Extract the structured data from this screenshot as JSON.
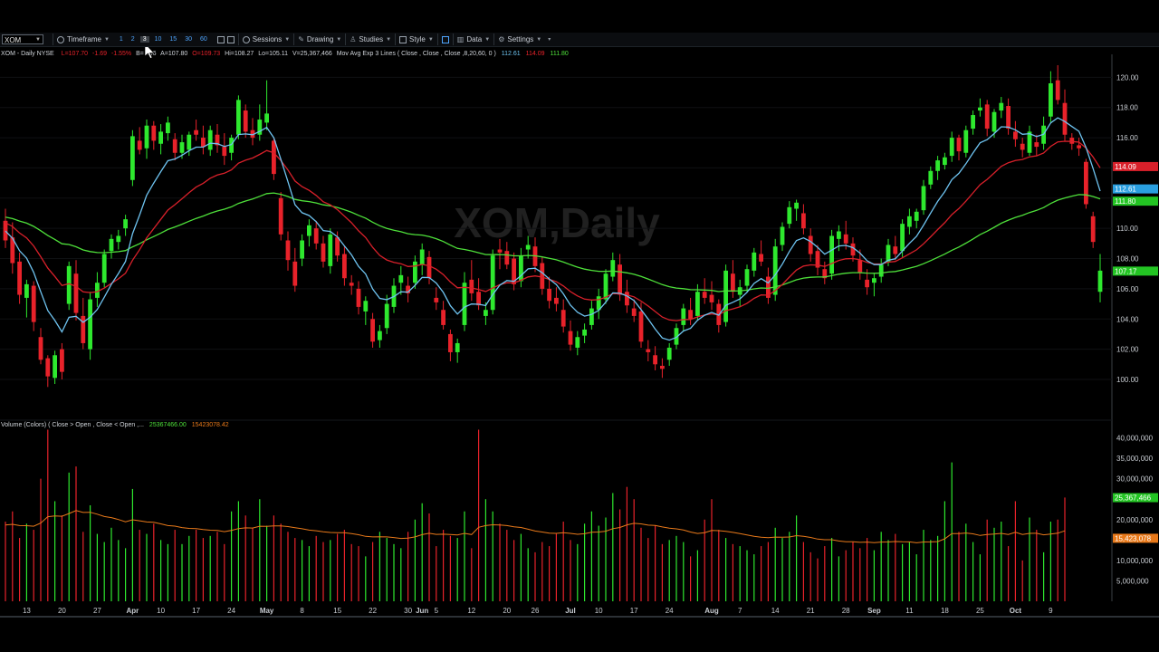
{
  "toolbar": {
    "symbol": "XOM",
    "timeframe": "Timeframe",
    "intervals": [
      "1",
      "2",
      "3",
      "10",
      "15",
      "30",
      "60"
    ],
    "selected_interval": "3",
    "sessions": "Sessions",
    "drawing": "Drawing",
    "studies": "Studies",
    "style": "Style",
    "data": "Data",
    "settings": "Settings"
  },
  "header": {
    "symbol_desc": "XOM - Daily  NYSE",
    "last": "L=107.70",
    "change": "-1.69",
    "change_pct": "-1.55%",
    "b": "B=",
    "b_val": ".06",
    "a": "A=107.80",
    "o": "O=109.73",
    "hi": "Hi=108.27",
    "lo": "Lo=105.11",
    "vol": "V=25,367,466",
    "study": "Mov Avg Exp 3 Lines ( Close , Close , Close ,8,20,60, 0 )",
    "ma1": "112.61",
    "ma2": "114.09",
    "ma3": "111.80"
  },
  "watermark": "XOM,Daily",
  "volume_header": {
    "label": "Volume (Colors) ( Close > Open , Close < Open ,...",
    "v1": "25367466.00",
    "v2": "15423078.42"
  },
  "colors": {
    "up": "#2ee82e",
    "down": "#e8222a",
    "ma_fast": "#6ec3f0",
    "ma_mid": "#d8202a",
    "ma_slow": "#4ee03a",
    "vol_avg": "#e8791a"
  },
  "chart_data": {
    "type": "candlestick",
    "price_ticks": [
      120.0,
      118.0,
      116.0,
      114.0,
      112.0,
      110.0,
      108.0,
      106.0,
      104.0,
      102.0,
      100.0
    ],
    "price_tick_labels": [
      "120.00",
      "118.00",
      "116.00",
      "",
      "",
      "110.00",
      "108.00",
      "106.00",
      "104.00",
      "102.00",
      "100.00"
    ],
    "price_range": [
      98.5,
      120.8
    ],
    "price_markers": [
      {
        "label": "114.09",
        "value": 114.09,
        "color": "#d8202a"
      },
      {
        "label": "112.61",
        "value": 112.61,
        "color": "#2a9fe0"
      },
      {
        "label": "111.80",
        "value": 111.8,
        "color": "#23c423"
      },
      {
        "label": "107.17",
        "value": 107.17,
        "color": "#23c423"
      }
    ],
    "volume_ticks": [
      40000000,
      35000000,
      30000000,
      25000000,
      20000000,
      15000000,
      10000000,
      5000000
    ],
    "volume_tick_labels": [
      "40,000,000",
      "35,000,000",
      "30,000,000",
      "",
      "20,000,000",
      "",
      "10,000,000",
      "5,000,000"
    ],
    "volume_range": [
      0,
      43000000
    ],
    "volume_markers": [
      {
        "label": "25,367,466",
        "value": 25367466,
        "color": "#23c423"
      },
      {
        "label": "15,423,078",
        "value": 15423078,
        "color": "#e8791a"
      }
    ],
    "x_labels": [
      {
        "label": "13",
        "bar": 3,
        "bold": false
      },
      {
        "label": "20",
        "bar": 8,
        "bold": false
      },
      {
        "label": "27",
        "bar": 13,
        "bold": false
      },
      {
        "label": "Apr",
        "bar": 18,
        "bold": true
      },
      {
        "label": "10",
        "bar": 22,
        "bold": false
      },
      {
        "label": "17",
        "bar": 27,
        "bold": false
      },
      {
        "label": "24",
        "bar": 32,
        "bold": false
      },
      {
        "label": "May",
        "bar": 37,
        "bold": true
      },
      {
        "label": "8",
        "bar": 42,
        "bold": false
      },
      {
        "label": "15",
        "bar": 47,
        "bold": false
      },
      {
        "label": "22",
        "bar": 52,
        "bold": false
      },
      {
        "label": "30",
        "bar": 57,
        "bold": false
      },
      {
        "label": "Jun",
        "bar": 59,
        "bold": true
      },
      {
        "label": "5",
        "bar": 61,
        "bold": false
      },
      {
        "label": "12",
        "bar": 66,
        "bold": false
      },
      {
        "label": "20",
        "bar": 71,
        "bold": false
      },
      {
        "label": "26",
        "bar": 75,
        "bold": false
      },
      {
        "label": "Jul",
        "bar": 80,
        "bold": true
      },
      {
        "label": "10",
        "bar": 84,
        "bold": false
      },
      {
        "label": "17",
        "bar": 89,
        "bold": false
      },
      {
        "label": "24",
        "bar": 94,
        "bold": false
      },
      {
        "label": "Aug",
        "bar": 100,
        "bold": true
      },
      {
        "label": "7",
        "bar": 104,
        "bold": false
      },
      {
        "label": "14",
        "bar": 109,
        "bold": false
      },
      {
        "label": "21",
        "bar": 114,
        "bold": false
      },
      {
        "label": "28",
        "bar": 119,
        "bold": false
      },
      {
        "label": "Sep",
        "bar": 123,
        "bold": true
      },
      {
        "label": "11",
        "bar": 128,
        "bold": false
      },
      {
        "label": "18",
        "bar": 133,
        "bold": false
      },
      {
        "label": "25",
        "bar": 138,
        "bold": false
      },
      {
        "label": "Oct",
        "bar": 143,
        "bold": true
      },
      {
        "label": "9",
        "bar": 148,
        "bold": false
      }
    ],
    "candles": [
      [
        110.5,
        111.3,
        108.7,
        109.2
      ],
      [
        109.4,
        110.4,
        107.0,
        107.7
      ],
      [
        107.8,
        108.4,
        105.0,
        105.6
      ],
      [
        105.4,
        106.6,
        104.1,
        106.3
      ],
      [
        106.2,
        106.5,
        103.2,
        103.8
      ],
      [
        102.8,
        103.4,
        101.0,
        101.3
      ],
      [
        101.4,
        101.6,
        99.5,
        100.2
      ],
      [
        100.1,
        101.9,
        99.7,
        101.6
      ],
      [
        102.0,
        102.4,
        100.0,
        100.5
      ],
      [
        105.0,
        107.8,
        104.6,
        107.5
      ],
      [
        107.0,
        107.9,
        103.9,
        104.4
      ],
      [
        104.2,
        105.4,
        102.0,
        102.4
      ],
      [
        102.0,
        105.8,
        101.3,
        105.3
      ],
      [
        105.4,
        107.1,
        104.8,
        106.4
      ],
      [
        106.4,
        108.6,
        106.1,
        108.3
      ],
      [
        108.5,
        109.6,
        108.0,
        109.3
      ],
      [
        109.1,
        109.9,
        108.6,
        109.5
      ],
      [
        110.0,
        110.9,
        109.5,
        110.6
      ],
      [
        113.2,
        116.5,
        112.8,
        116.1
      ],
      [
        115.8,
        116.7,
        114.9,
        115.2
      ],
      [
        115.3,
        117.2,
        114.6,
        116.8
      ],
      [
        116.8,
        117.1,
        115.2,
        115.8
      ],
      [
        115.6,
        116.9,
        114.9,
        116.4
      ],
      [
        116.3,
        117.4,
        115.8,
        117.0
      ],
      [
        115.9,
        116.3,
        114.5,
        115.0
      ],
      [
        115.0,
        116.2,
        114.6,
        115.7
      ],
      [
        115.2,
        116.4,
        114.8,
        116.2
      ],
      [
        116.5,
        117.2,
        115.8,
        116.2
      ],
      [
        116.0,
        116.8,
        114.9,
        115.4
      ],
      [
        115.2,
        116.8,
        114.8,
        116.5
      ],
      [
        116.2,
        116.9,
        115.0,
        115.5
      ],
      [
        115.4,
        116.3,
        114.2,
        114.8
      ],
      [
        115.0,
        116.2,
        114.5,
        116.0
      ],
      [
        116.2,
        118.8,
        115.9,
        118.5
      ],
      [
        117.8,
        118.2,
        116.0,
        116.4
      ],
      [
        116.5,
        117.3,
        115.5,
        116.0
      ],
      [
        116.2,
        118.2,
        115.8,
        117.2
      ],
      [
        117.0,
        119.8,
        116.5,
        117.6
      ],
      [
        115.8,
        116.0,
        113.2,
        113.6
      ],
      [
        112.0,
        112.4,
        109.2,
        109.6
      ],
      [
        109.2,
        109.8,
        107.2,
        107.9
      ],
      [
        107.8,
        108.7,
        105.8,
        106.2
      ],
      [
        108.0,
        109.6,
        107.5,
        109.2
      ],
      [
        109.5,
        110.6,
        108.8,
        110.2
      ],
      [
        110.0,
        110.5,
        108.6,
        109.0
      ],
      [
        109.0,
        109.5,
        107.4,
        107.8
      ],
      [
        107.5,
        110.0,
        107.0,
        109.6
      ],
      [
        109.4,
        109.8,
        107.8,
        108.2
      ],
      [
        108.3,
        108.8,
        106.2,
        106.7
      ],
      [
        106.4,
        106.9,
        105.6,
        106.2
      ],
      [
        106.0,
        106.5,
        104.3,
        104.8
      ],
      [
        104.5,
        105.5,
        103.6,
        105.2
      ],
      [
        104.0,
        104.4,
        102.1,
        102.5
      ],
      [
        102.6,
        103.6,
        102.1,
        103.2
      ],
      [
        103.4,
        105.6,
        103.0,
        105.0
      ],
      [
        104.8,
        106.7,
        104.4,
        106.2
      ],
      [
        106.4,
        107.5,
        105.6,
        106.9
      ],
      [
        106.2,
        106.8,
        105.1,
        105.7
      ],
      [
        106.4,
        108.2,
        106.0,
        107.8
      ],
      [
        107.6,
        109.0,
        106.9,
        108.6
      ],
      [
        108.1,
        108.5,
        106.3,
        106.7
      ],
      [
        105.4,
        106.1,
        104.6,
        105.1
      ],
      [
        104.6,
        105.2,
        103.3,
        103.6
      ],
      [
        103.0,
        103.3,
        101.2,
        101.8
      ],
      [
        101.8,
        102.7,
        101.1,
        102.4
      ],
      [
        103.6,
        107.1,
        103.2,
        106.4
      ],
      [
        106.6,
        107.9,
        105.2,
        105.7
      ],
      [
        105.8,
        106.7,
        104.6,
        104.9
      ],
      [
        104.2,
        105.1,
        103.6,
        104.6
      ],
      [
        104.6,
        108.6,
        104.3,
        108.2
      ],
      [
        108.6,
        109.3,
        107.3,
        108.4
      ],
      [
        108.5,
        109.1,
        107.3,
        107.6
      ],
      [
        108.0,
        108.4,
        105.9,
        106.3
      ],
      [
        106.5,
        108.7,
        106.1,
        108.2
      ],
      [
        108.6,
        109.5,
        108.0,
        108.9
      ],
      [
        108.8,
        109.4,
        107.1,
        107.5
      ],
      [
        107.7,
        108.1,
        105.6,
        106.0
      ],
      [
        106.0,
        106.8,
        104.7,
        105.2
      ],
      [
        105.4,
        106.1,
        104.5,
        105.0
      ],
      [
        104.6,
        105.3,
        103.1,
        103.5
      ],
      [
        103.2,
        103.9,
        101.9,
        102.3
      ],
      [
        102.1,
        103.2,
        101.6,
        102.8
      ],
      [
        102.9,
        103.7,
        102.4,
        103.3
      ],
      [
        103.6,
        105.2,
        103.3,
        104.7
      ],
      [
        104.6,
        106.0,
        104.0,
        105.5
      ],
      [
        105.3,
        107.3,
        105.0,
        107.0
      ],
      [
        106.8,
        108.4,
        106.5,
        107.9
      ],
      [
        107.6,
        108.3,
        105.2,
        105.6
      ],
      [
        105.8,
        106.6,
        104.4,
        104.9
      ],
      [
        104.7,
        105.3,
        103.8,
        104.2
      ],
      [
        104.5,
        105.1,
        102.1,
        102.5
      ],
      [
        102.0,
        102.6,
        101.2,
        101.8
      ],
      [
        101.6,
        102.2,
        100.6,
        101.0
      ],
      [
        100.9,
        101.4,
        100.1,
        100.7
      ],
      [
        101.3,
        102.4,
        100.9,
        102.1
      ],
      [
        102.3,
        103.7,
        102.0,
        103.4
      ],
      [
        103.6,
        105.0,
        103.2,
        104.7
      ],
      [
        104.6,
        105.4,
        103.6,
        104.0
      ],
      [
        104.2,
        106.3,
        103.9,
        105.8
      ],
      [
        105.8,
        106.7,
        105.0,
        105.4
      ],
      [
        105.6,
        106.5,
        104.6,
        105.1
      ],
      [
        105.0,
        105.3,
        103.1,
        103.6
      ],
      [
        103.8,
        107.6,
        103.5,
        107.2
      ],
      [
        107.0,
        107.9,
        105.4,
        105.8
      ],
      [
        105.6,
        106.6,
        104.8,
        106.1
      ],
      [
        106.2,
        107.6,
        105.8,
        107.3
      ],
      [
        107.2,
        108.7,
        106.8,
        108.4
      ],
      [
        108.3,
        109.2,
        107.5,
        107.8
      ],
      [
        106.8,
        107.4,
        105.0,
        105.4
      ],
      [
        105.6,
        109.3,
        105.2,
        108.8
      ],
      [
        108.9,
        110.4,
        108.5,
        110.1
      ],
      [
        110.3,
        111.8,
        110.0,
        111.4
      ],
      [
        111.3,
        111.9,
        110.5,
        111.7
      ],
      [
        111.0,
        111.6,
        109.6,
        110.0
      ],
      [
        109.5,
        110.0,
        107.8,
        108.3
      ],
      [
        108.5,
        108.9,
        106.9,
        107.4
      ],
      [
        107.3,
        107.8,
        106.3,
        106.7
      ],
      [
        107.0,
        109.9,
        106.6,
        109.5
      ],
      [
        109.3,
        110.2,
        108.5,
        109.8
      ],
      [
        109.6,
        110.5,
        108.6,
        109.0
      ],
      [
        109.0,
        109.4,
        107.8,
        108.2
      ],
      [
        107.9,
        108.6,
        106.6,
        107.1
      ],
      [
        106.6,
        107.3,
        105.6,
        106.1
      ],
      [
        106.4,
        107.0,
        105.5,
        106.7
      ],
      [
        106.8,
        108.0,
        106.4,
        107.6
      ],
      [
        107.8,
        109.3,
        107.5,
        108.9
      ],
      [
        108.8,
        109.5,
        107.9,
        108.3
      ],
      [
        108.5,
        110.6,
        108.1,
        110.3
      ],
      [
        110.1,
        111.3,
        109.6,
        110.8
      ],
      [
        110.5,
        111.3,
        110.0,
        111.1
      ],
      [
        111.2,
        113.2,
        110.9,
        112.8
      ],
      [
        112.9,
        114.1,
        112.6,
        113.8
      ],
      [
        113.8,
        114.8,
        113.2,
        114.5
      ],
      [
        114.2,
        115.0,
        113.9,
        114.7
      ],
      [
        114.8,
        116.4,
        114.4,
        116.0
      ],
      [
        116.0,
        116.2,
        114.5,
        115.1
      ],
      [
        115.0,
        116.8,
        114.7,
        116.5
      ],
      [
        116.6,
        117.8,
        116.2,
        117.5
      ],
      [
        117.8,
        118.6,
        117.4,
        118.0
      ],
      [
        118.2,
        118.5,
        116.1,
        116.6
      ],
      [
        116.4,
        117.9,
        116.0,
        117.7
      ],
      [
        117.8,
        118.7,
        117.3,
        118.3
      ],
      [
        118.1,
        118.6,
        116.2,
        116.6
      ],
      [
        116.4,
        117.1,
        115.4,
        115.9
      ],
      [
        115.6,
        116.0,
        114.7,
        115.2
      ],
      [
        115.0,
        116.8,
        114.8,
        116.4
      ],
      [
        115.7,
        116.2,
        114.8,
        115.4
      ],
      [
        115.6,
        117.4,
        115.2,
        116.8
      ],
      [
        117.4,
        120.4,
        117.0,
        119.6
      ],
      [
        119.8,
        120.8,
        118.2,
        118.5
      ],
      [
        118.3,
        119.2,
        115.8,
        116.2
      ],
      [
        116.0,
        116.3,
        115.2,
        115.6
      ],
      [
        115.5,
        116.0,
        114.8,
        115.3
      ],
      [
        114.4,
        114.6,
        111.3,
        111.6
      ],
      [
        110.8,
        111.1,
        108.7,
        109.1
      ],
      [
        105.8,
        108.3,
        105.1,
        107.2
      ]
    ],
    "volumes": [
      19.5,
      22.0,
      15.5,
      19.0,
      17.5,
      30.0,
      42.0,
      24.5,
      21.0,
      31.5,
      33.0,
      17.0,
      23.5,
      16.5,
      14.5,
      18.0,
      15.0,
      13.0,
      27.5,
      17.5,
      16.5,
      19.0,
      15.0,
      14.0,
      17.5,
      14.0,
      16.0,
      17.5,
      15.5,
      16.0,
      17.0,
      14.0,
      22.0,
      24.5,
      21.0,
      18.0,
      25.0,
      18.5,
      21.0,
      19.0,
      17.0,
      15.5,
      15.0,
      13.5,
      16.0,
      14.5,
      15.0,
      16.5,
      17.5,
      14.0,
      13.5,
      11.0,
      14.5,
      17.0,
      15.5,
      14.0,
      13.0,
      17.0,
      20.0,
      24.0,
      21.5,
      13.5,
      17.5,
      16.0,
      15.5,
      22.0,
      13.0,
      42.0,
      25.0,
      22.0,
      19.0,
      17.5,
      15.0,
      16.5,
      13.0,
      12.0,
      14.5,
      13.5,
      16.5,
      19.5,
      15.0,
      14.0,
      19.0,
      22.0,
      18.5,
      20.5,
      26.5,
      22.5,
      28.0,
      25.0,
      18.0,
      15.5,
      18.5,
      14.0,
      15.0,
      16.0,
      14.5,
      11.0,
      12.5,
      20.0,
      25.0,
      17.5,
      15.5,
      14.0,
      13.5,
      12.5,
      11.5,
      13.5,
      14.5,
      18.0,
      15.5,
      17.0,
      21.0,
      14.5,
      12.0,
      10.5,
      13.5,
      15.5,
      11.0,
      12.5,
      14.5,
      13.0,
      15.5,
      12.5,
      17.0,
      15.0,
      16.5,
      14.0,
      14.5,
      11.5,
      17.5,
      15.0,
      16.0,
      24.5,
      34.0,
      17.0,
      19.0,
      14.5,
      11.5,
      20.0,
      18.0,
      19.5,
      13.5,
      24.5,
      10.0,
      20.5,
      17.5,
      12.0,
      19.5,
      20.0,
      25.4
    ]
  }
}
